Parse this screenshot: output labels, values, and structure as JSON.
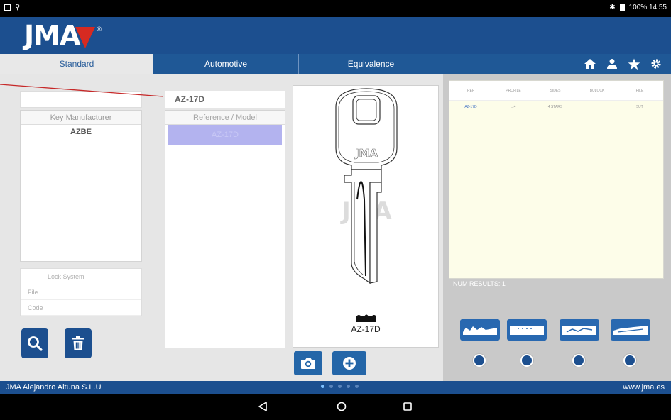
{
  "status_bar": {
    "right_text": "100% 14:55"
  },
  "header": {
    "logo_text": "JMA",
    "logo_reg": "®"
  },
  "tabs": [
    {
      "label": "Standard",
      "active": true
    },
    {
      "label": "Automotive",
      "active": false
    },
    {
      "label": "Equivalence",
      "active": false
    }
  ],
  "toolbar_icons": [
    "home-icon",
    "user-icon",
    "star-icon",
    "gear-icon"
  ],
  "left_panel": {
    "search_value": "",
    "manufacturer_header": "Key Manufacturer",
    "manufacturers": [
      "AZBE"
    ],
    "lock_fields": [
      "Lock System",
      "File",
      "Code"
    ]
  },
  "reference_panel": {
    "search_value": "AZ-17D",
    "header": "Reference / Model",
    "selected": "AZ-17D"
  },
  "key_panel": {
    "brand_on_key": "JMA",
    "watermark": "JMA",
    "caption": "AZ-17D"
  },
  "results": {
    "columns": [
      "REF",
      "PROFILE",
      "SIDES",
      "BULOCK",
      "FILE"
    ],
    "rows": [
      [
        "AZ-17D",
        "...4",
        "4 STARS",
        "",
        "5UT"
      ]
    ],
    "num_results_label": "NUM RESULTS: 1"
  },
  "blade_icons": [
    "blade-type-1-icon",
    "blade-type-2-icon",
    "blade-type-3-icon",
    "blade-type-4-icon"
  ],
  "footer": {
    "company": "JMA Alejandro Altuna S.L.U",
    "website": "www.jma.es",
    "page_dots_count": 5,
    "active_dot": 0
  },
  "colors": {
    "brand_blue": "#1c4f8f",
    "brand_red": "#d62a21",
    "selection": "#b3b3ef",
    "results_bg": "#fdfde9",
    "annotation_line": "#c62828"
  }
}
